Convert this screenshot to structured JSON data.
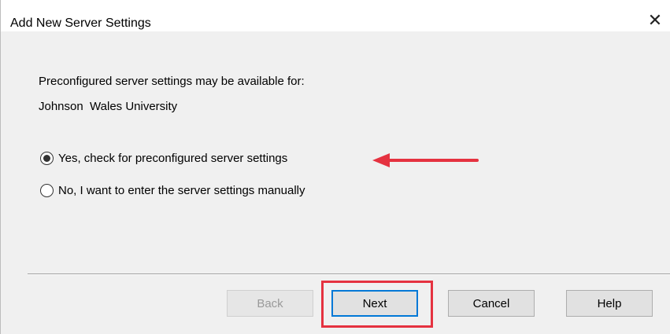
{
  "window": {
    "title": "Add New Server Settings",
    "close_label": "✕"
  },
  "content": {
    "intro": "Preconfigured server settings may be available for:",
    "organization": "Johnson  Wales University"
  },
  "options": [
    {
      "label": "Yes, check for preconfigured server settings",
      "selected": true
    },
    {
      "label": "No, I want to enter the server settings manually",
      "selected": false
    }
  ],
  "buttons": {
    "back": {
      "label": "Back",
      "enabled": false
    },
    "next": {
      "label": "Next",
      "default": true
    },
    "cancel": {
      "label": "Cancel"
    },
    "help": {
      "label": "Help"
    }
  },
  "annotations": {
    "arrow_color": "#e53240",
    "highlight_color": "#e53240",
    "focus_color": "#0078d7"
  }
}
